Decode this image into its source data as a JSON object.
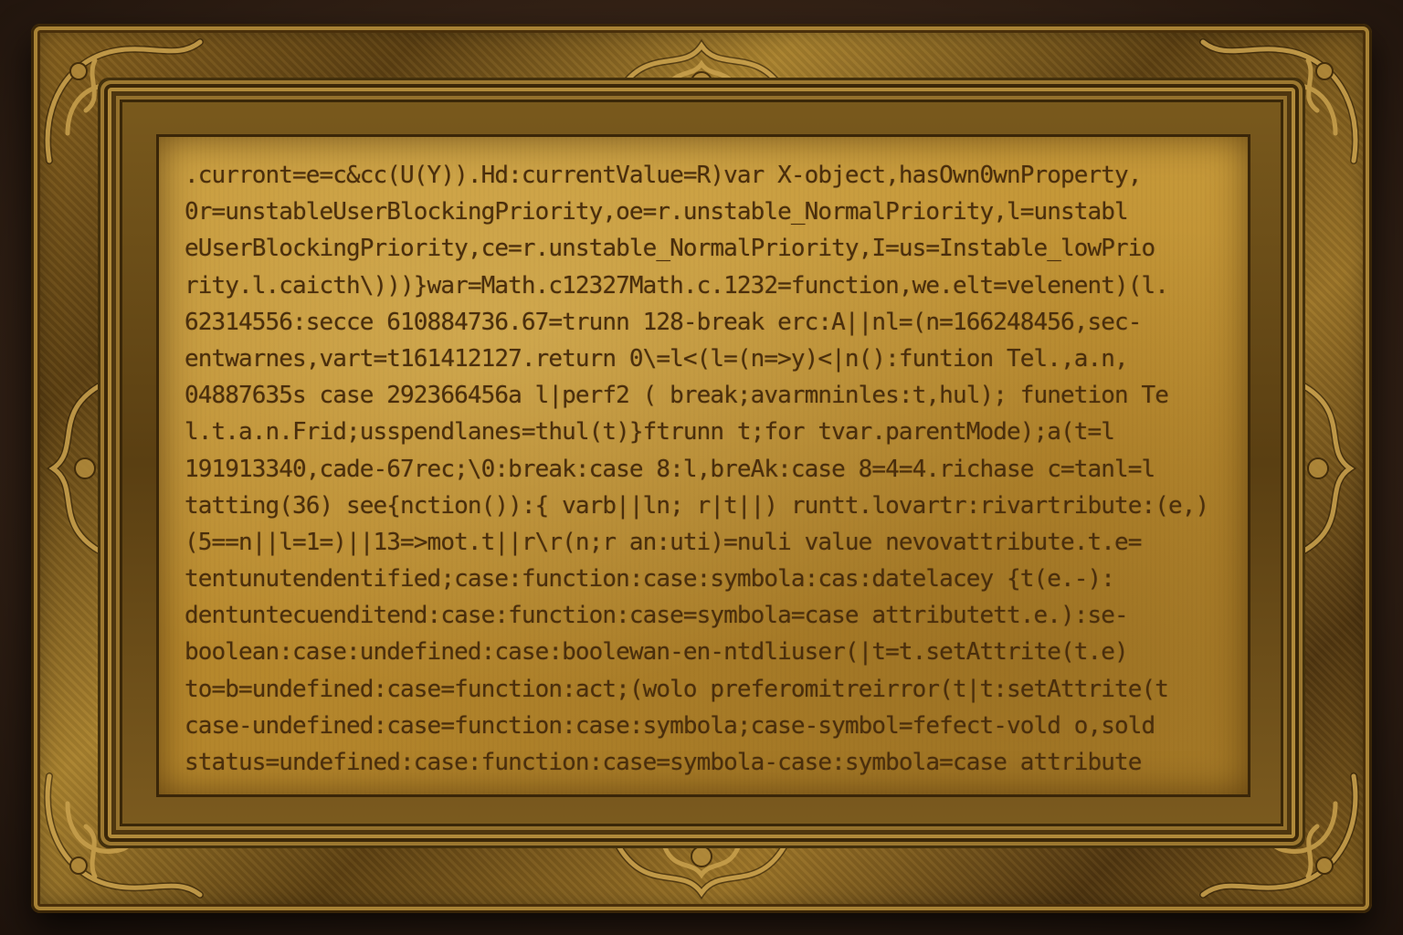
{
  "painting": {
    "code_lines": [
      ".curront=e=c&cc(U(Y)).Hd:currentValue=R)var X-object,hasOwn0wnProperty,",
      "0r=unstableUserBlockingPriority,oe=r.unstable_NormalPriority,l=unstabl",
      "eUserBlockingPriority,ce=r.unstable_NormalPriority,I=us=Instable_lowPrio",
      "rity.l.caicth\\)))}war=Math.c12327Math.c.1232=function,we.elt=velenent)(l.",
      "62314556:secce 610884736.67=trunn 128-break erc:A||nl=(n=166248456,sec-",
      "entwarnes,vart=t161412127.return 0\\=l<(l=(n=>y)<|n():funtion Tel.,a.n,",
      "04887635s case 292366456a l|perf2 ( break;avarmninles:t,hul); funetion Te",
      "l.t.a.n.Frid;usspendlanes=thul(t)}ftrunn t;for tvar.parentMode);a(t=l",
      "191913340,cade-67rec;\\0:break:case 8:l,breAk:case 8=4=4.richase c=tanl=l",
      "tatting(36) see{nction()):{ varb||ln; r|t||) runtt.lovartr:rivartribute:(e,)",
      "(5==n||l=1=)||13=>mot.t||r\\r(n;r an:uti)=nuli value nevovattribute.t.e=",
      "tentunutendentified;case:function:case:symbola:cas:datelacey {t(e.-):",
      "dentuntecuenditend:case:function:case=symbola=case attributett.e.):se-",
      "boolean:case:undefined:case:boolewan-en-ntdliuser(|t=t.setAttrite(t.e)",
      "to=b=undefined:case=function:act;(wolo preferomitreirror(t|t:setAttrite(t",
      "case-undefined:case=function:case:symbola;case-symbol=fefect-vold o,sold",
      "status=undefined:case:function:case=symbola-case:symbola=case attribute"
    ]
  },
  "colors": {
    "frame_gold": "#a9822f",
    "canvas": "#bb8c2f",
    "text": "#4a2e0c",
    "wall": "#342216"
  }
}
